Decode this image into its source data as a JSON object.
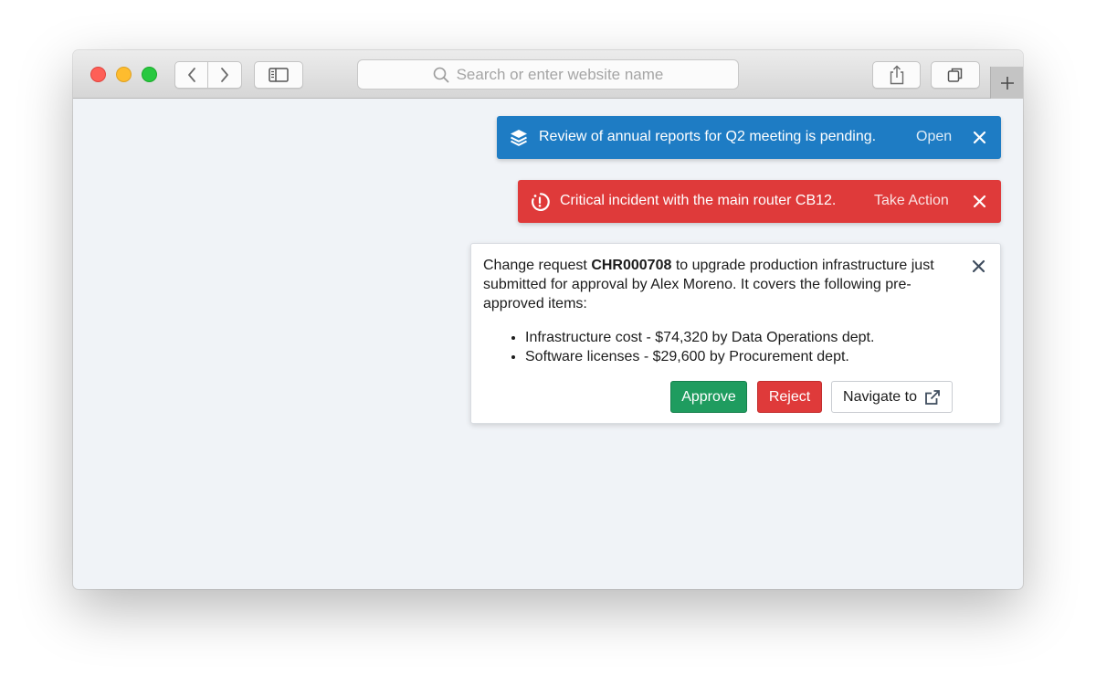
{
  "browser": {
    "address_placeholder": "Search or enter website name"
  },
  "notifications": [
    {
      "type": "info",
      "color": "#1e7cc4",
      "icon": "layers-icon",
      "message": "Review of annual reports for Q2 meeting is pending.",
      "action": "Open"
    },
    {
      "type": "danger",
      "color": "#df3a3a",
      "icon": "alert-clock-icon",
      "message": "Critical incident with the main router CB12.",
      "action": "Take Action"
    }
  ],
  "change_request": {
    "prefix": "Change request ",
    "id": "CHR000708",
    "body": " to upgrade production infrastructure just submitted for approval by Alex Moreno. It covers the following pre-approved items:",
    "items": [
      "Infrastructure cost - $74,320 by Data Operations dept.",
      "Software licenses - $29,600 by Procurement dept."
    ],
    "approve_label": "Approve",
    "reject_label": "Reject",
    "navigate_label": "Navigate to",
    "colors": {
      "approve": "#1f9c5f",
      "reject": "#df3a3a"
    }
  }
}
